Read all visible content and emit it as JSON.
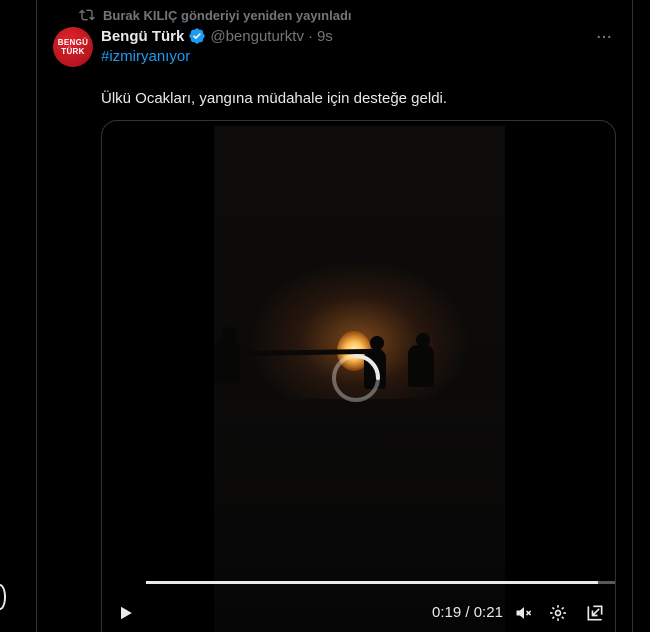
{
  "repost": {
    "text": "Burak KILIÇ gönderiyi yeniden yayınladı",
    "icon": "repost-icon"
  },
  "author": {
    "avatar_line1": "BENGÜ",
    "avatar_line2": "TÜRK",
    "display_name": "Bengü Türk",
    "verified_icon": "verified-badge-icon",
    "handle": "@benguturktv",
    "separator": "·",
    "time": "9s"
  },
  "more_icon": "more-icon",
  "tweet": {
    "hashtag": "#izmiryanıyor",
    "text": "Ülkü Ocakları, yangına müdahale için desteğe geldi."
  },
  "video": {
    "current_time": "0:19",
    "time_separator": " / ",
    "duration": "0:21",
    "progress": 0.91,
    "controls": [
      "play-icon",
      "mute-icon",
      "settings-icon",
      "pip-icon",
      "fullscreen-icon"
    ]
  },
  "colors": {
    "accent": "#1d9bf0",
    "text_primary": "#e7e9ea",
    "text_secondary": "#71767b",
    "border": "#2f3336",
    "background": "#000000"
  }
}
